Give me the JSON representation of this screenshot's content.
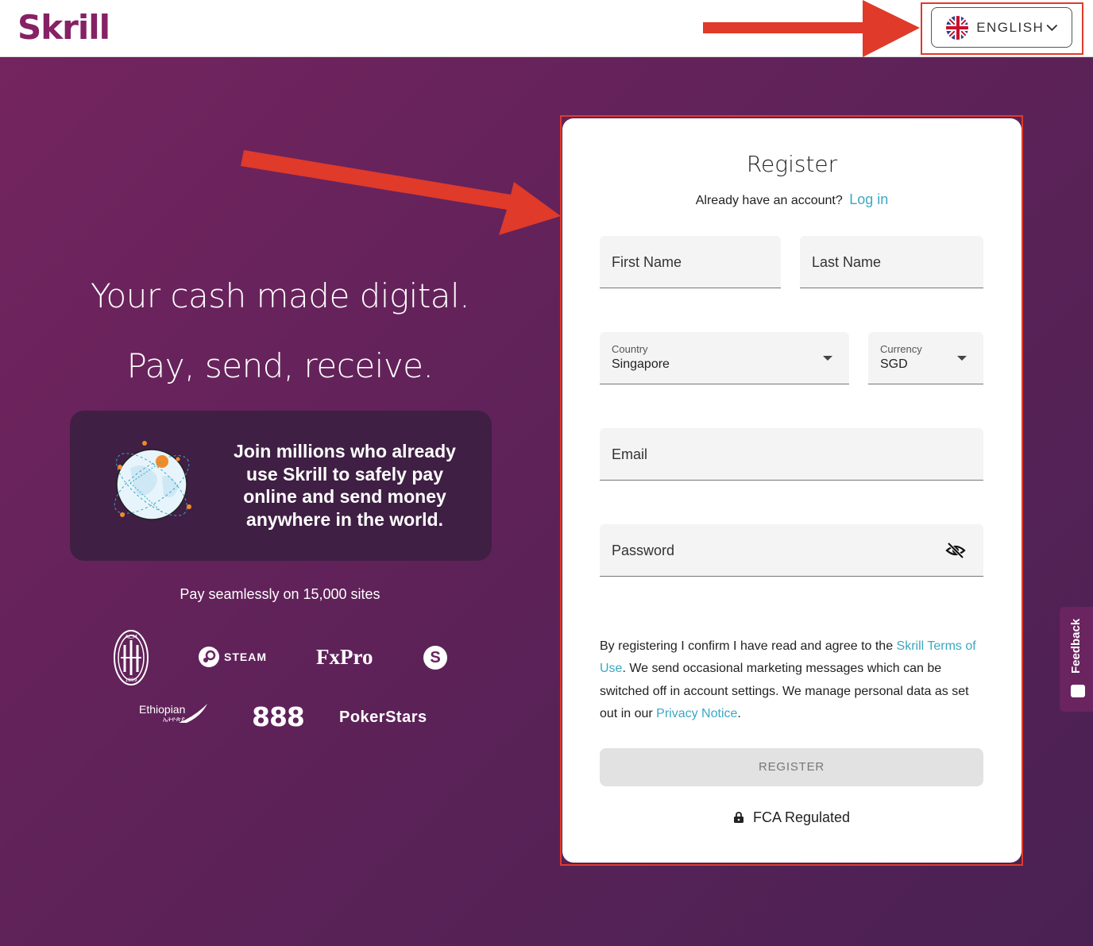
{
  "header": {
    "logo": "Skrill",
    "language": "ENGLISH"
  },
  "hero": {
    "headline1": "Your cash made digital.",
    "headline2": "Pay, send, receive.",
    "join_line1": "Join millions who already",
    "join_line2": "use Skrill to safely pay",
    "join_line3": "online and send money",
    "join_line4": "anywhere in the world.",
    "seamless": "Pay seamlessly on 15,000 sites",
    "brands": {
      "acm": "ACM 1899",
      "steam": "STEAM",
      "fxpro": "FxPro",
      "skype": "S",
      "ethiopian": "Ethiopian",
      "ethiopian_sub": "ኢትዮጵያ",
      "e888": "888",
      "pokerstars": "PokerStars"
    }
  },
  "register": {
    "title": "Register",
    "already": "Already have an account?",
    "login": "Log in",
    "first_name": "First Name",
    "last_name": "Last Name",
    "country_label": "Country",
    "country_value": "Singapore",
    "currency_label": "Currency",
    "currency_value": "SGD",
    "email": "Email",
    "password": "Password",
    "terms_part1": "By registering I confirm I have read and agree to the ",
    "terms_link1": "Skrill Terms of Use",
    "terms_part2": ". We send occasional marketing messages which can be switched off in account settings. We manage personal data as set out in our ",
    "terms_link2": "Privacy Notice",
    "terms_part3": ".",
    "button": "REGISTER",
    "fca": "FCA Regulated"
  },
  "feedback": "Feedback",
  "colors": {
    "brand": "#862165",
    "link": "#3aa8c2",
    "annotation": "#e03a2a"
  }
}
